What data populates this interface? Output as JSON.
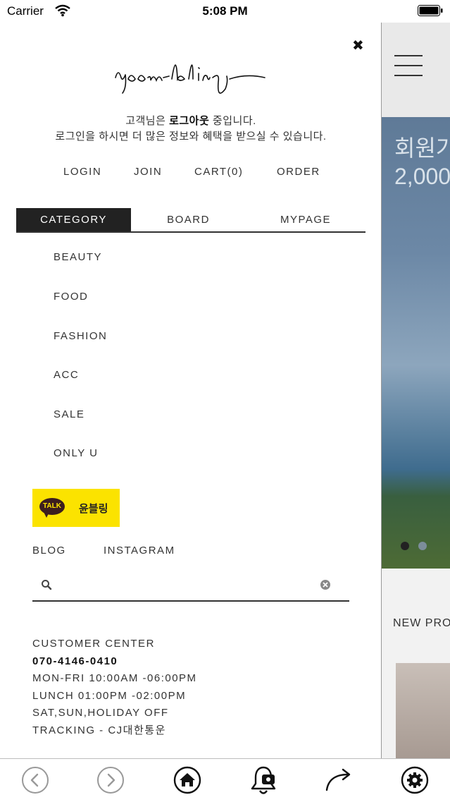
{
  "status_bar": {
    "carrier": "Carrier",
    "time": "5:08 PM"
  },
  "drawer": {
    "notice_line1_prefix": "고객님은 ",
    "notice_line1_bold": "로그아웃",
    "notice_line1_suffix": " 중입니다.",
    "notice_line2": "로그인을 하시면 더 많은 정보와 혜택을 받으실 수 있습니다.",
    "links": {
      "login": "LOGIN",
      "join": "JOIN",
      "cart": "CART(0)",
      "order": "ORDER"
    },
    "tabs": [
      "CATEGORY",
      "BOARD",
      "MYPAGE"
    ],
    "categories": [
      "BEAUTY",
      "FOOD",
      "FASHION",
      "ACC",
      "SALE",
      "ONLY U"
    ],
    "kakao": {
      "badge": "TALK",
      "label": "윤블링"
    },
    "social": {
      "blog": "BLOG",
      "instagram": "INSTAGRAM"
    },
    "search": {
      "value": "",
      "placeholder": ""
    },
    "customer_center": {
      "title": "CUSTOMER CENTER",
      "phone": "070-4146-0410",
      "hours": "MON-FRI 10:00AM -06:00PM",
      "lunch": "LUNCH 01:00PM -02:00PM",
      "holiday": "SAT,SUN,HOLIDAY OFF",
      "tracking": "TRACKING - CJ대한통운"
    }
  },
  "background_page": {
    "banner_line1": "회원가",
    "banner_line2": "2,000",
    "section_title": "NEW PRO"
  },
  "toolbar": {
    "icons": [
      "back-icon",
      "forward-icon",
      "home-icon",
      "notification-bell-icon",
      "share-icon",
      "settings-gear-icon"
    ]
  },
  "colors": {
    "kakao_yellow": "#fbe300",
    "active_tab": "#222222",
    "text": "#333333"
  }
}
